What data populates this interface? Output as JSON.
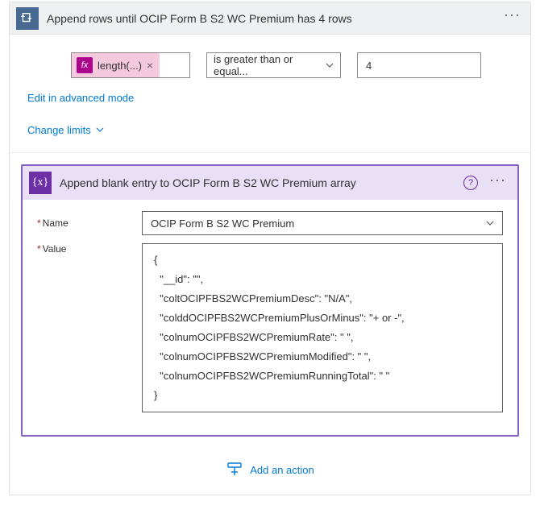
{
  "outerAction": {
    "title": "Append rows until OCIP Form B S2 WC Premium has 4 rows"
  },
  "condition": {
    "fxLabel": "fx",
    "fxExpr": "length(...)",
    "operator": "is greater than or equal...",
    "rightValue": "4"
  },
  "links": {
    "editAdvanced": "Edit in advanced mode",
    "changeLimits": "Change limits",
    "addAction": "Add an action"
  },
  "innerAction": {
    "title": "Append blank entry to OCIP Form B S2 WC Premium array",
    "nameLabel": "Name",
    "nameValue": "OCIP Form B S2 WC Premium",
    "valueLabel": "Value",
    "valueText": "{\n  \"__id\": \"\",\n  \"coltOCIPFBS2WCPremiumDesc\": \"N/A\",\n  \"colddOCIPFBS2WCPremiumPlusOrMinus\": \"+ or -\",\n  \"colnumOCIPFBS2WCPremiumRate\": \" \",\n  \"colnumOCIPFBS2WCPremiumModified\": \" \",\n  \"colnumOCIPFBS2WCPremiumRunningTotal\": \" \"\n}"
  }
}
